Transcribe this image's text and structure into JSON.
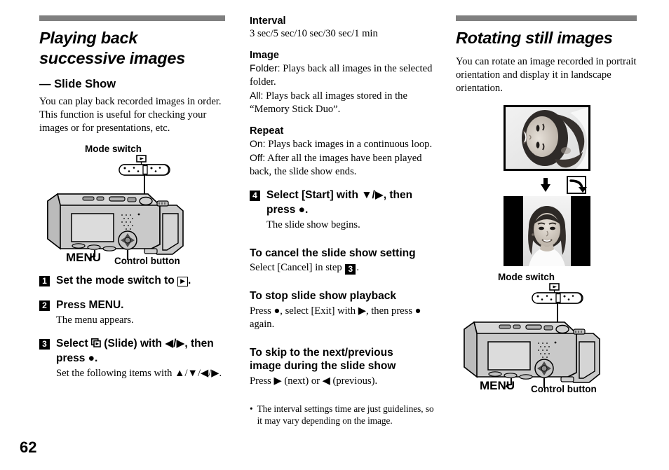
{
  "page": {
    "number": "62"
  },
  "colors": {
    "rule": "#808080",
    "ink": "#000000",
    "paper": "#ffffff",
    "camera_body": "#c8c8c8"
  },
  "left_column": {
    "title_line1": "Playing back",
    "title_line2": "successive images",
    "subtitle": "— Slide Show",
    "intro": "You can play back recorded images in order. This function is useful for checking your images or for presentations, etc.",
    "figure": {
      "mode_switch_label": "Mode switch",
      "mode_switch_glyph": "▶",
      "menu_label": "MENU",
      "control_button_label": "Control button"
    },
    "steps": [
      {
        "number": "1",
        "text_before": "Set the mode switch to ",
        "glyph": "▶",
        "text_after": ".",
        "sub": ""
      },
      {
        "number": "2",
        "text_before": "Press MENU.",
        "glyph": "",
        "text_after": "",
        "sub": "The menu appears."
      },
      {
        "number": "3",
        "text_before": "Select ",
        "glyph": "slide-icon",
        "text_after": " (Slide) with ◀/▶, then press ●.",
        "sub": "Set the following items with ▲/▼/◀/▶."
      }
    ]
  },
  "middle_column": {
    "settings": [
      {
        "name": "Interval",
        "lines": [
          {
            "label": "",
            "text": "3 sec/5 sec/10 sec/30 sec/1 min"
          }
        ]
      },
      {
        "name": "Image",
        "lines": [
          {
            "label": "Folder:",
            "text": " Plays back all images in the selected folder."
          },
          {
            "label": "All:",
            "text": " Plays back all images stored in the “Memory Stick Duo”."
          }
        ]
      },
      {
        "name": "Repeat",
        "lines": [
          {
            "label": "On:",
            "text": " Plays back images in a continuous loop."
          },
          {
            "label": "Off:",
            "text": " After all the images have been played back, the slide show ends."
          }
        ]
      }
    ],
    "step4": {
      "number": "4",
      "text": "Select [Start] with ▼/▶, then press ●.",
      "sub": "The slide show begins."
    },
    "procedures": [
      {
        "heading": "To cancel the slide show setting",
        "body_before": "Select [Cancel] in step ",
        "step_ref": "3",
        "body_after": "."
      },
      {
        "heading": "To stop slide show playback",
        "body_before": "Press ●, select [Exit] with ▶, then press ● again.",
        "step_ref": "",
        "body_after": ""
      },
      {
        "heading_line1": "To skip to the next/previous",
        "heading_line2": "image during the slide show",
        "body_before": "Press ▶ (next) or ◀ (previous).",
        "step_ref": "",
        "body_after": ""
      }
    ],
    "note": {
      "bullet": "•",
      "text": "The interval settings time are just guidelines, so it may vary depending on the image."
    }
  },
  "right_column": {
    "title": "Rotating still images",
    "intro": "You can rotate an image recorded in portrait orientation and display it in landscape orientation.",
    "rotation_figure": {
      "arrow_glyph": "↓",
      "rotate_icon_name": "rotate-icon"
    },
    "figure": {
      "mode_switch_label": "Mode switch",
      "mode_switch_glyph": "▶",
      "menu_label": "MENU",
      "control_button_label": "Control button"
    }
  }
}
